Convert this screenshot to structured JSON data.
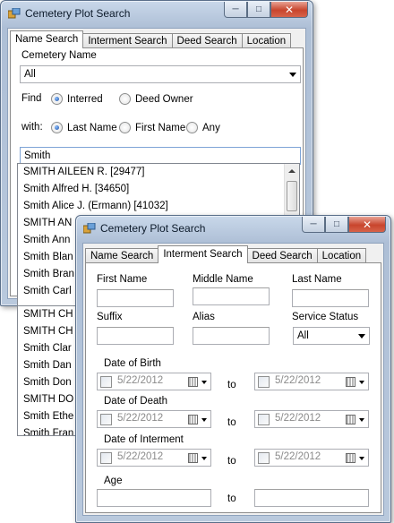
{
  "window1": {
    "title": "Cemetery Plot Search",
    "tabs": [
      "Name Search",
      "Interment Search",
      "Deed Search",
      "Location"
    ],
    "cemetery_label": "Cemetery Name",
    "cemetery_value": "All",
    "find_label": "Find",
    "find_options": [
      "Interred",
      "Deed Owner"
    ],
    "with_label": "with:",
    "with_options": [
      "Last Name",
      "First Name",
      "Any"
    ],
    "search_value": "Smith",
    "results": [
      "SMITH AILEEN R.  [29477]",
      "Smith Alfred H.  [34650]",
      "Smith Alice J. (Ermann)  [41032]",
      "SMITH AN",
      "Smith Ann",
      "Smith Blan",
      "Smith Bran",
      "Smith Carl",
      "SMITH CH",
      "SMITH CH",
      "Smith Clar",
      "Smith Dan",
      "Smith Don",
      "SMITH DO",
      "Smith Ethe",
      "Smith Fran"
    ]
  },
  "window2": {
    "title": "Cemetery Plot Search",
    "tabs": [
      "Name Search",
      "Interment Search",
      "Deed Search",
      "Location"
    ],
    "first_name_label": "First Name",
    "middle_name_label": "Middle Name",
    "last_name_label": "Last Name",
    "suffix_label": "Suffix",
    "alias_label": "Alias",
    "service_status_label": "Service Status",
    "service_status_value": "All",
    "dob_label": "Date of Birth",
    "dod_label": "Date of Death",
    "doi_label": "Date of Interment",
    "age_label": "Age",
    "to_label": "to",
    "date_value": "5/22/2012"
  }
}
